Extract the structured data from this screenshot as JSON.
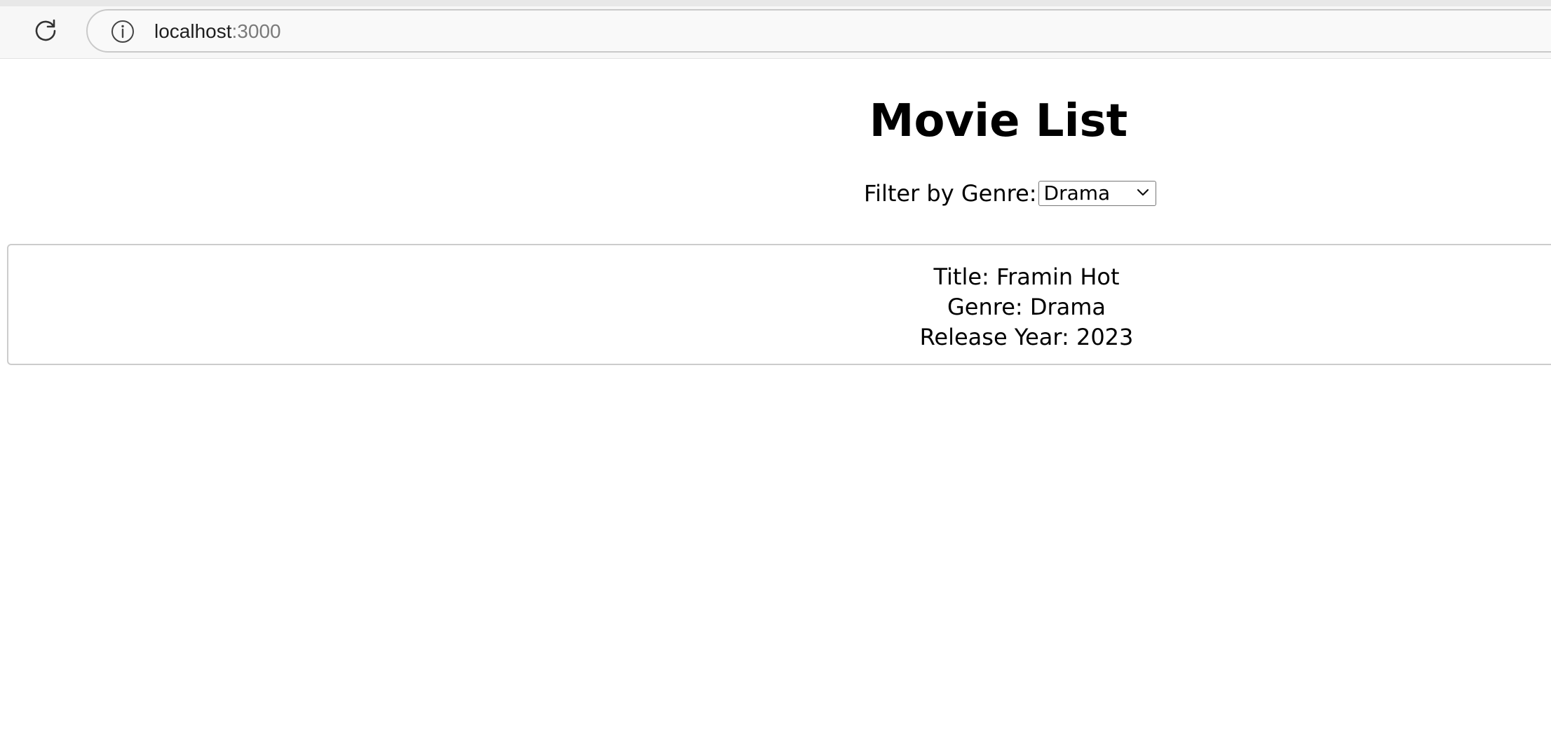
{
  "browser": {
    "url_host": "localhost",
    "url_port": ":3000",
    "icons": [
      "reload-icon",
      "info-icon"
    ]
  },
  "page": {
    "title": "Movie List",
    "filter_label": "Filter by Genre:",
    "filter_selected": "Drama"
  },
  "movies": [
    {
      "title_line": "Title: Framin Hot",
      "genre_line": "Genre: Drama",
      "year_line": "Release Year: 2023"
    }
  ],
  "colors": {
    "background": "#ffffff",
    "toolbar": "#f7f7f7",
    "card_border": "#cccccc"
  }
}
